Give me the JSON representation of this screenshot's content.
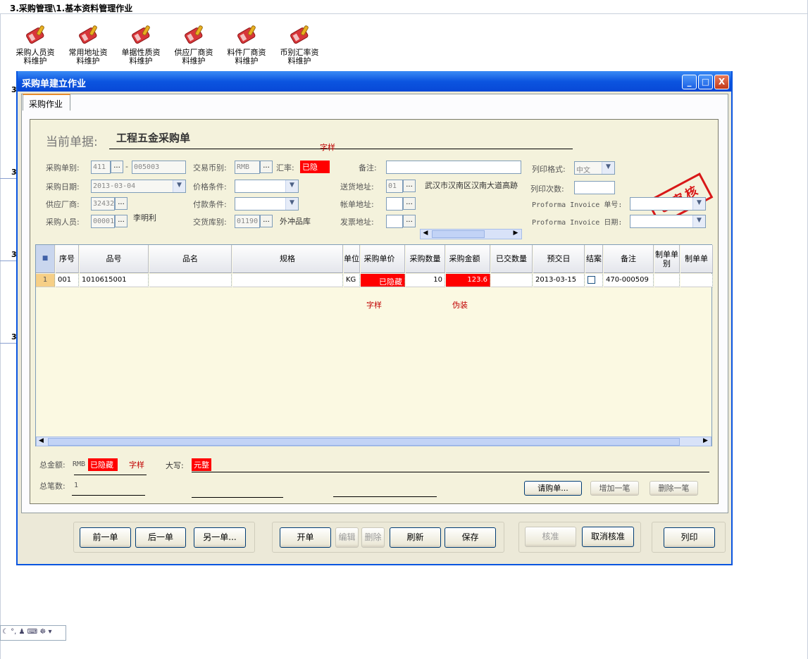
{
  "breadcrumb": "3.采购管理\\1.基本资料管理作业",
  "launcher": [
    {
      "l1": "采购人员资",
      "l2": "料维护"
    },
    {
      "l1": "常用地址资",
      "l2": "料维护"
    },
    {
      "l1": "单据性质资",
      "l2": "料维护"
    },
    {
      "l1": "供应厂商资",
      "l2": "料维护"
    },
    {
      "l1": "料件厂商资",
      "l2": "料维护"
    },
    {
      "l1": "币别汇率资",
      "l2": "料维护"
    }
  ],
  "bg_numbers": [
    "3",
    "3",
    "3",
    "3"
  ],
  "window": {
    "title": "采购单建立作业",
    "min": "_",
    "max": "□",
    "close": "X"
  },
  "tab": "采购作业",
  "doc": {
    "label": "当前单据:",
    "name": "工程五金采购单",
    "watermark": "字样"
  },
  "stamp": "已审核",
  "form": {
    "po_type_label": "采购单别:",
    "po_type": "411",
    "dash": "-",
    "po_no": "005003",
    "currency_label": "交易币别:",
    "currency": "RMB",
    "rate_label": "汇率:",
    "rate": "已隐",
    "remark_label": "备注:",
    "print_format_label": "列印格式:",
    "print_format": "中文",
    "po_date_label": "采购日期:",
    "po_date": "2013-03-04",
    "price_label": "价格条件:",
    "ship_addr_label": "送货地址:",
    "ship_addr": "01",
    "ship_addr_text": "武汉市汉南区汉南大道高跡",
    "print_count_label": "列印次数:",
    "vendor_label": "供应厂商:",
    "vendor": "32432",
    "pay_label": "付款条件:",
    "bill_addr_label": "帐单地址:",
    "pi_no_label": "Proforma Invoice 单号:",
    "buyer_label": "采购人员:",
    "buyer_code": "00001",
    "buyer_name": "李明利",
    "wh_label": "交货库别:",
    "wh_code": "01190",
    "wh_name": "外冲品库",
    "inv_addr_label": "发票地址:",
    "pi_date_label": "Proforma Invoice 日期:"
  },
  "grid": {
    "headers": [
      {
        "id": "lock",
        "t": ""
      },
      {
        "id": "seq",
        "t": "序号"
      },
      {
        "id": "pno",
        "t": "品号"
      },
      {
        "id": "pname",
        "t": "品名"
      },
      {
        "id": "spec",
        "t": "规格"
      },
      {
        "id": "unit",
        "t": "单位"
      },
      {
        "id": "price",
        "t": "采购单价"
      },
      {
        "id": "qty",
        "t": "采购数量"
      },
      {
        "id": "amt",
        "t": "采购金额"
      },
      {
        "id": "delivered",
        "t": "已交数量"
      },
      {
        "id": "due",
        "t": "预交日"
      },
      {
        "id": "closed",
        "t": "结案"
      },
      {
        "id": "memo",
        "t": "备注"
      },
      {
        "id": "mk_type",
        "t": "制单单别"
      },
      {
        "id": "mk_no",
        "t": "制单单"
      }
    ],
    "row": {
      "rn": "1",
      "seq": "001",
      "pno": "1010615001",
      "pname": "",
      "spec": "",
      "unit": "KG",
      "price": "已隐藏",
      "qty": "10",
      "amt": "123.6",
      "delivered": "",
      "due": "2013-03-15",
      "memo": "470-000509"
    },
    "wm1": "字样",
    "wm2": "伪装"
  },
  "totals": {
    "amt_label": "总金额:",
    "cur": "RMB",
    "amt": "已隐藏",
    "amt_wm": "字样",
    "cap_label": "大写:",
    "cap": "元整",
    "count_label": "总笔数:",
    "count": "1"
  },
  "actions": {
    "req": "请购单...",
    "add": "增加一笔",
    "del": "删除一笔"
  },
  "nav": {
    "prev": "前一单",
    "next": "后一单",
    "other": "另一单...",
    "open": "开单",
    "edit": "编辑",
    "delete": "删除",
    "refresh": "刷新",
    "save": "保存",
    "approve": "核准",
    "unapprove": "取消核准",
    "print": "列印"
  }
}
